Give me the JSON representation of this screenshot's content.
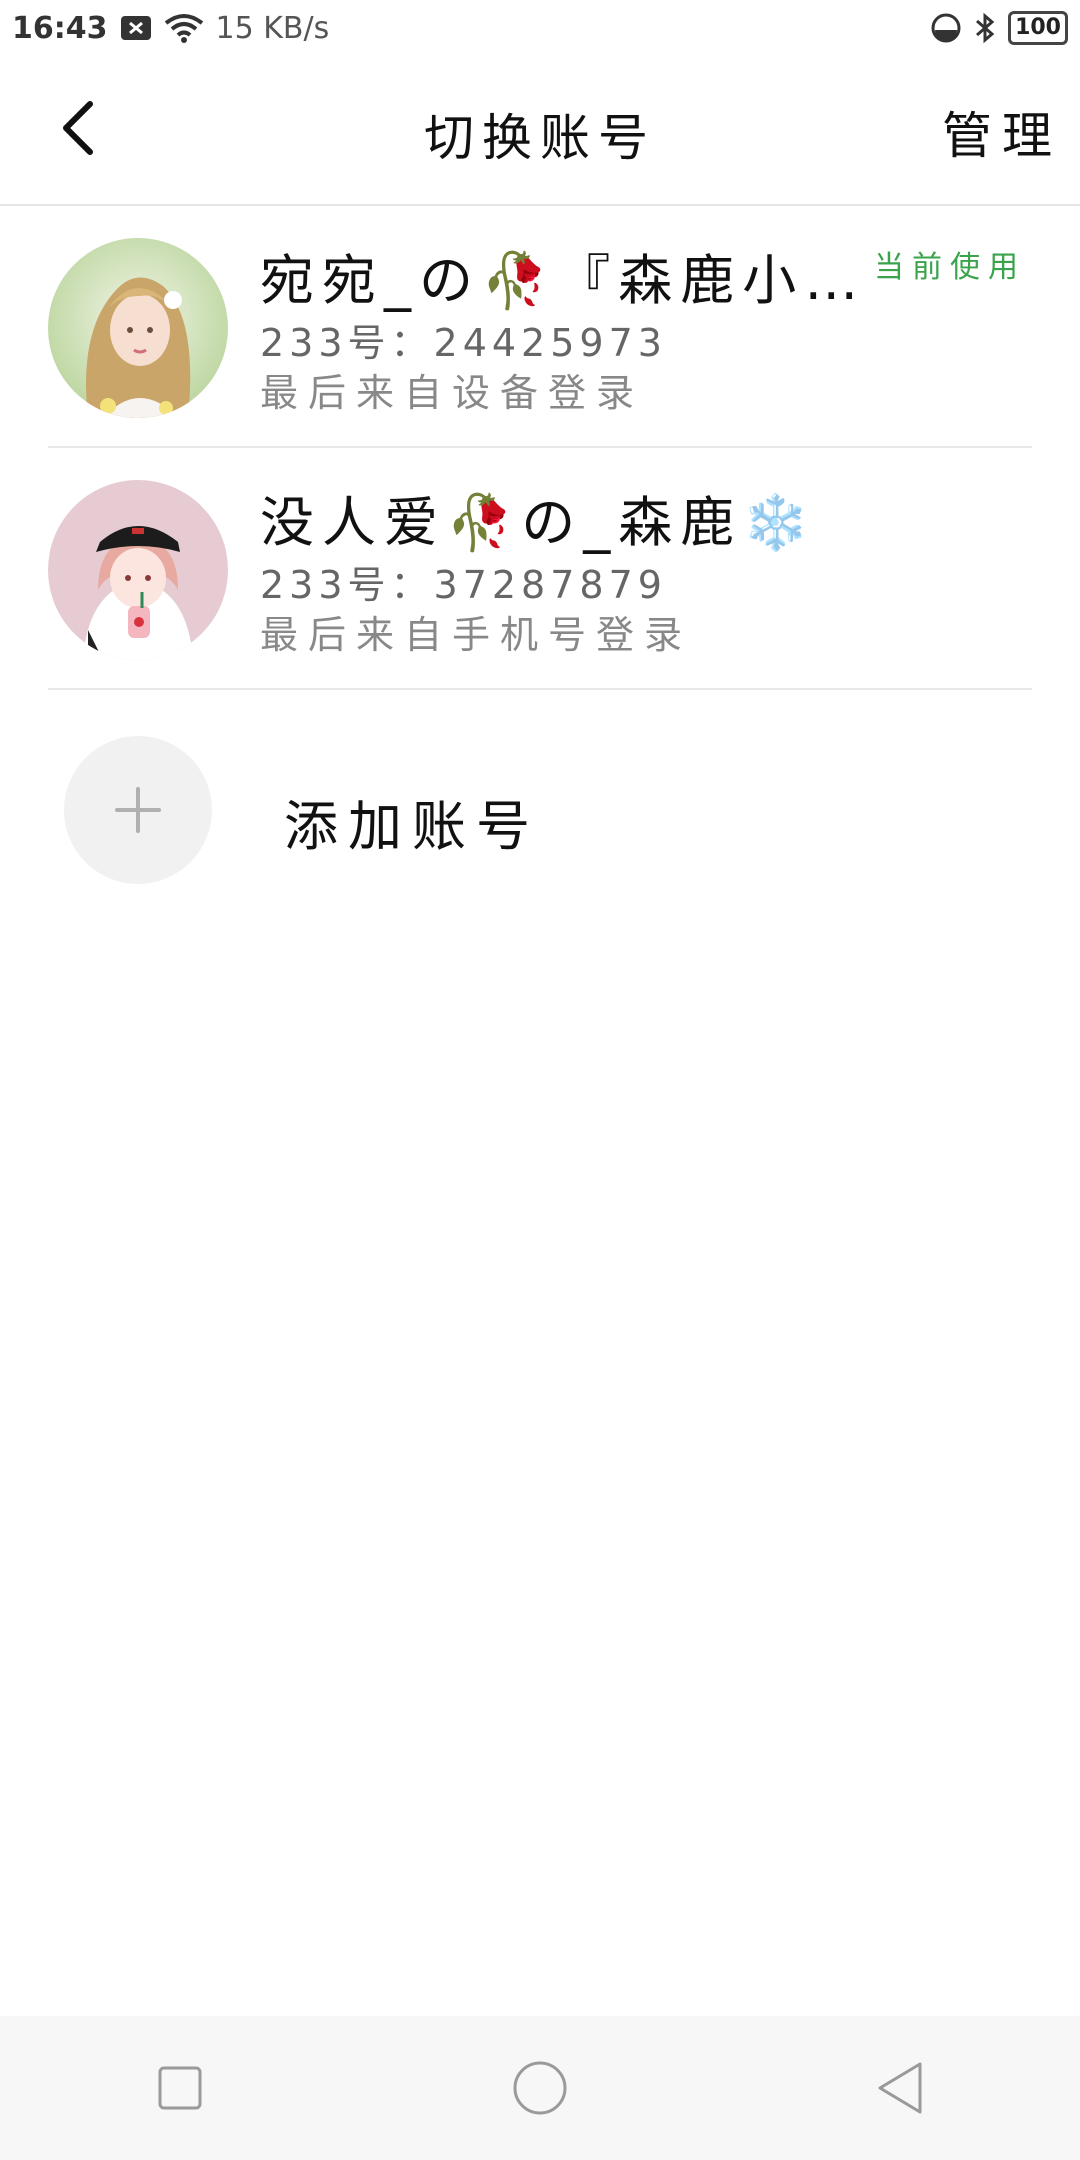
{
  "status_bar": {
    "time": "16:43",
    "net_speed": "15 KB/s",
    "battery": "100",
    "icons": [
      "notification-x-icon",
      "wifi-icon",
      "data-saver-icon",
      "bluetooth-icon",
      "battery-icon"
    ]
  },
  "header": {
    "title": "切换账号",
    "manage": "管理"
  },
  "accounts": [
    {
      "name": "宛宛_の🥀『森鹿小…",
      "id_line": "233号：24425973",
      "last_login": "最后来自设备登录",
      "current_badge": "当前使用",
      "is_current": true
    },
    {
      "name": "没人爱🥀の_森鹿❄️",
      "id_line": "233号：37287879",
      "last_login": "最后来自手机号登录",
      "current_badge": "",
      "is_current": false
    }
  ],
  "add_account": {
    "label": "添加账号"
  },
  "colors": {
    "accent_green": "#3aa34c",
    "divider": "#e8e8e8",
    "add_circle_bg": "#f1f1f1",
    "navbar_bg": "#f7f7f7"
  }
}
